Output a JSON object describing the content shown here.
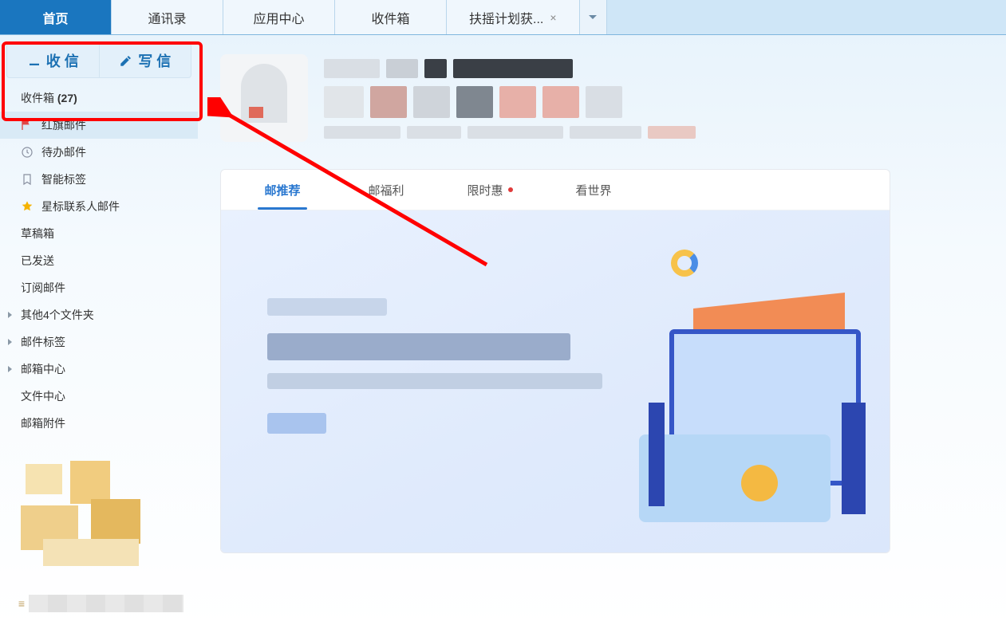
{
  "tabs": {
    "home": "首页",
    "contacts": "通讯录",
    "apps": "应用中心",
    "inbox_tab": "收件箱",
    "message_tab": "扶摇计划获...",
    "more_symbol": "⌄"
  },
  "compose": {
    "receive": "收 信",
    "write": "写 信"
  },
  "sidebar": {
    "inbox_label": "收件箱",
    "inbox_count": "(27)",
    "flagged": "红旗邮件",
    "todo": "待办邮件",
    "smart_tag": "智能标签",
    "star_contacts": "星标联系人邮件",
    "drafts": "草稿箱",
    "sent": "已发送",
    "subscribed": "订阅邮件",
    "other_folders": "其他4个文件夹",
    "mail_tags": "邮件标签",
    "mail_center": "邮箱中心",
    "file_center": "文件中心",
    "attachments": "邮箱附件"
  },
  "card_tabs": {
    "recommend": "邮推荐",
    "welfare": "邮福利",
    "limited": "限时惠",
    "world": "看世界"
  }
}
